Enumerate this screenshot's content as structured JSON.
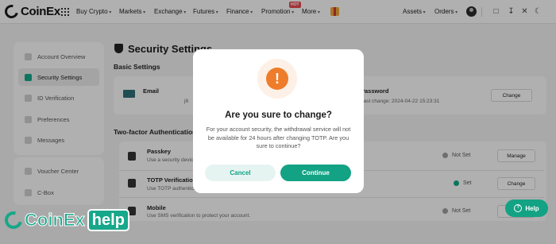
{
  "brand": {
    "name": "CoinEx",
    "accent": "#13a284",
    "warning": "#ee7c2a"
  },
  "nav": {
    "items": [
      "Buy Crypto",
      "Markets",
      "Exchange",
      "Futures",
      "Finance",
      "Promotion",
      "More"
    ],
    "hot_badge": "HOT",
    "right_items": [
      "Assets",
      "Orders"
    ]
  },
  "sidebar": {
    "items": [
      {
        "label": "Account Overview",
        "icon": "overview-icon"
      },
      {
        "label": "Security Settings",
        "icon": "shield-icon",
        "active": true
      },
      {
        "label": "ID Verification",
        "icon": "id-card-icon"
      },
      {
        "label": "Preferences",
        "icon": "preferences-icon"
      },
      {
        "label": "Messages",
        "icon": "message-icon"
      }
    ],
    "items2": [
      {
        "label": "Voucher Center",
        "icon": "voucher-icon"
      },
      {
        "label": "C-Box",
        "icon": "box-icon"
      }
    ]
  },
  "main": {
    "title": "Security Settings",
    "basic_label": "Basic Settings",
    "email": {
      "label": "Email",
      "value": "j8"
    },
    "password": {
      "label": "Password",
      "last_change": "Last change: 2024-04-22 15:23:31",
      "button": "Change"
    },
    "twofa_label": "Two-factor Authentication",
    "rows": [
      {
        "label": "Passkey",
        "desc": "Use a security device",
        "status": "Not Set",
        "ok": false,
        "button": "Manage"
      },
      {
        "label": "TOTP Verification",
        "desc": "Use TOTP authentication",
        "status": "Set",
        "ok": true,
        "button": "Change"
      },
      {
        "label": "Mobile",
        "desc": "Use SMS verification to protect your account.",
        "status": "Not Set",
        "ok": false,
        "button": "Set"
      }
    ]
  },
  "modal": {
    "icon": "!",
    "title": "Are you sure to change?",
    "body": "For your account security, the withdrawal service will not be available for 24 hours after changing TOTP. Are you sure to continue?",
    "cancel": "Cancel",
    "continue": "Continue"
  },
  "help": {
    "label": "Help",
    "icon": "?"
  },
  "watermark": {
    "text": "CoinEx",
    "help": "help"
  }
}
